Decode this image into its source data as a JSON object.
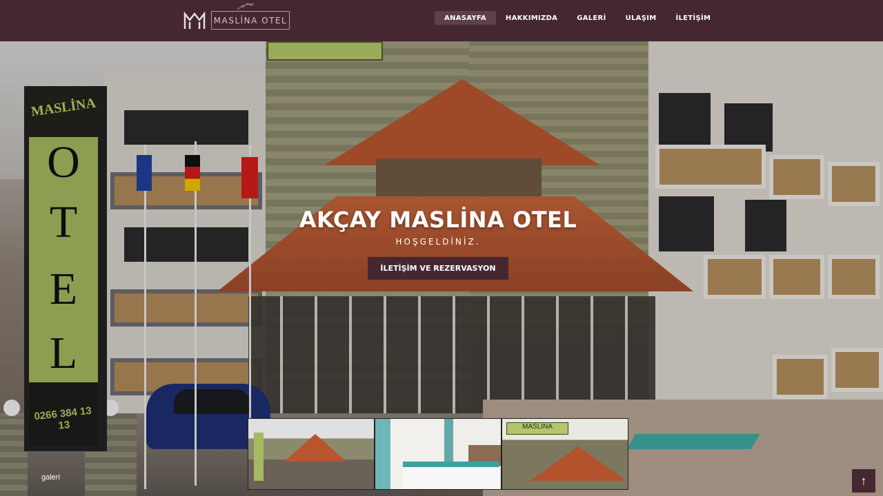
{
  "brand": {
    "logo_text": "MASLİNA OTEL"
  },
  "nav": {
    "items": [
      {
        "label": "ANASAYFA",
        "active": true
      },
      {
        "label": "HAKKIMIZDA",
        "active": false
      },
      {
        "label": "GALERİ",
        "active": false
      },
      {
        "label": "ULAŞIM",
        "active": false
      },
      {
        "label": "İLETİŞİM",
        "active": false
      }
    ]
  },
  "hero": {
    "title": "AKÇAY MASLİNA OTEL",
    "subtitle": "HOŞGELDİNİZ.",
    "cta_label": "İLETİŞİM VE REZERVASYON",
    "sign_top": "MASLİNA",
    "sign_letters": [
      "O",
      "T",
      "E",
      "L"
    ],
    "sign_phone": "0266 384 13 13"
  },
  "gallery": {
    "label": "galeri",
    "thumb3_sign": "MASLİNA"
  },
  "to_top": {
    "icon": "arrow-up-icon",
    "glyph": "↑"
  },
  "colors": {
    "brand": "#452732",
    "nav_active": "#5d4049",
    "text": "#ffffff"
  }
}
